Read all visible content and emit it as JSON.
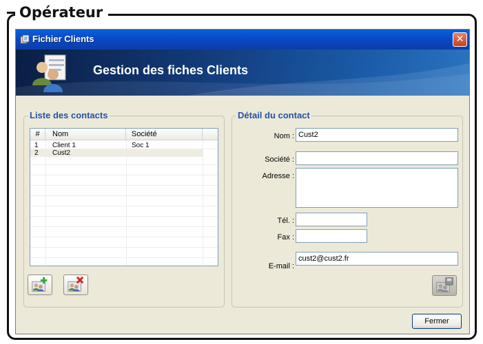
{
  "outer": {
    "legend": "Opérateur"
  },
  "window": {
    "title": "Fichier Clients",
    "close_label": "✕",
    "banner_title": "Gestion des fiches Clients"
  },
  "list_group": {
    "legend": "Liste des contacts",
    "columns": [
      "#",
      "Nom",
      "Société"
    ],
    "rows": [
      {
        "num": "1",
        "nom": "Client 1",
        "societe": "Soc 1"
      },
      {
        "num": "2",
        "nom": "Cust2",
        "societe": ""
      }
    ],
    "selected_row": 2,
    "add_button_icon": "add-contact-icon",
    "delete_button_icon": "delete-contact-icon"
  },
  "detail_group": {
    "legend": "Détail du contact",
    "labels": {
      "nom": "Nom :",
      "societe": "Société :",
      "adresse": "Adresse :",
      "tel": "Tél. :",
      "fax": "Fax :",
      "email": "E-mail :"
    },
    "values": {
      "nom": "Cust2",
      "societe": "",
      "adresse": "",
      "tel": "",
      "fax": "",
      "email": "cust2@cust2.fr"
    },
    "save_button_icon": "save-contact-icon"
  },
  "footer": {
    "close_button": "Fermer"
  },
  "colors": {
    "titlebar": "#0a5fd8",
    "legend_text": "#2452a8",
    "window_bg": "#ece9d8"
  }
}
